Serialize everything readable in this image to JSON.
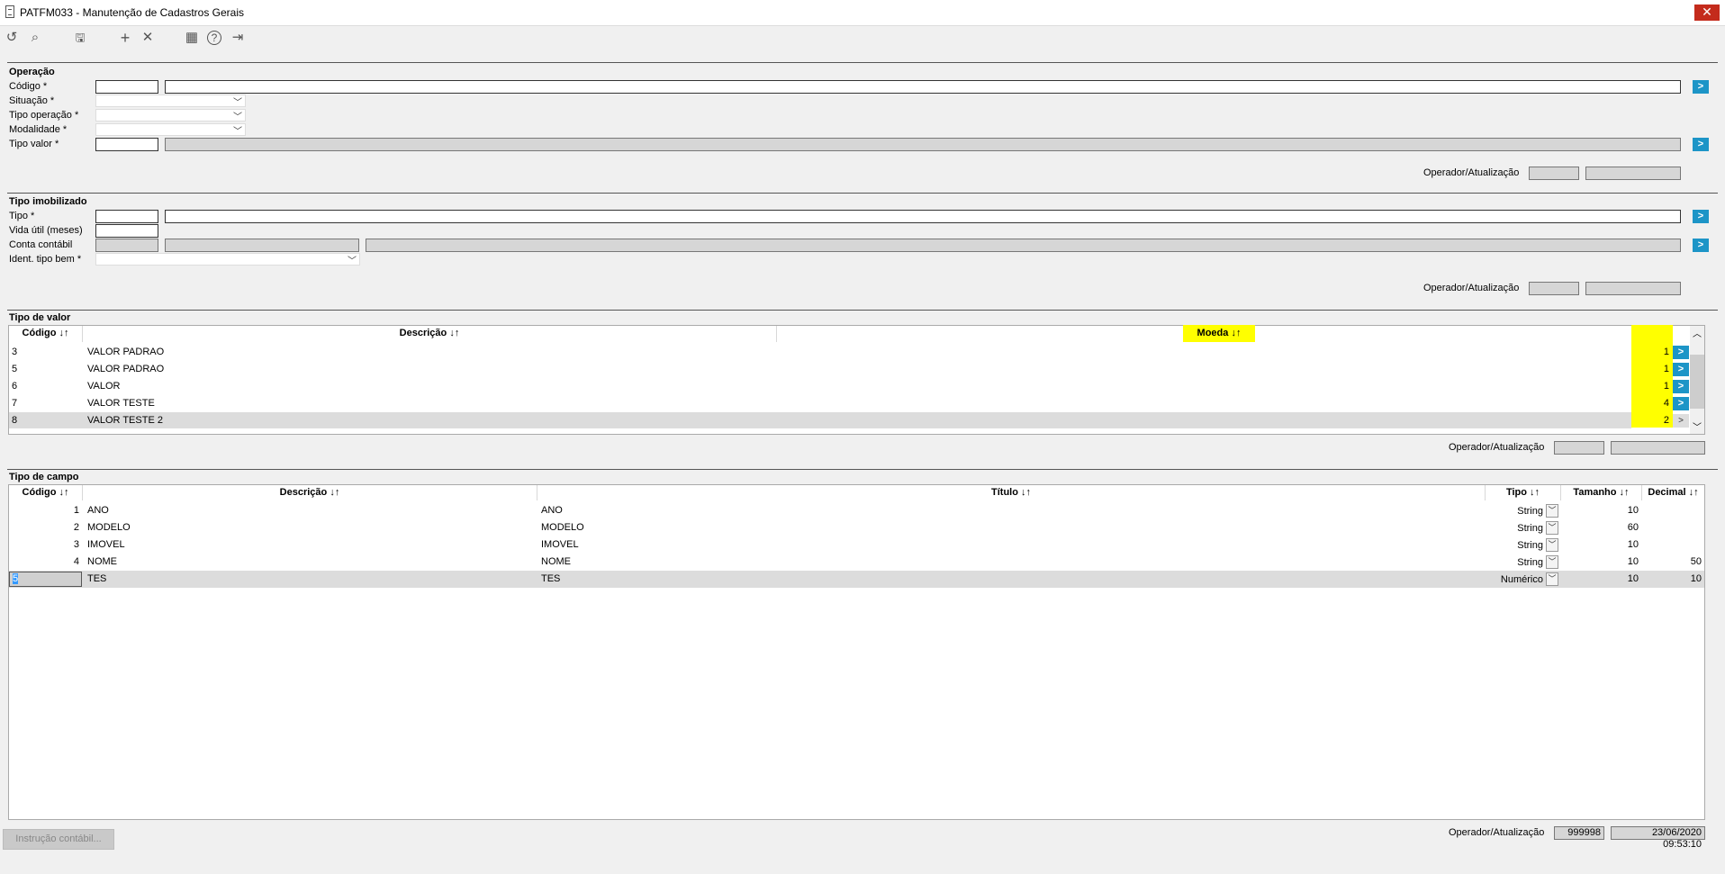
{
  "window": {
    "title": "PATFM033 - Manutenção de Cadastros Gerais",
    "close": "✕"
  },
  "toolbar": {
    "refresh": "↺",
    "search": "⌕",
    "save": "🖫",
    "add": "+",
    "remove": "✕",
    "calendar": "▦",
    "help": "?",
    "exit": "⇥"
  },
  "operacao": {
    "title": "Operação",
    "codigo": "Código *",
    "situacao": "Situação *",
    "tipo_operacao": "Tipo operação *",
    "modalidade": "Modalidade *",
    "tipo_valor": "Tipo valor *",
    "operador_label": "Operador/Atualização"
  },
  "tipo_imobilizado": {
    "title": "Tipo imobilizado",
    "tipo": "Tipo *",
    "vida_util": "Vida útil (meses)",
    "conta_contabil": "Conta contábil",
    "ident_tipo_bem": "Ident. tipo bem *",
    "operador_label": "Operador/Atualização"
  },
  "tipo_valor": {
    "title": "Tipo de valor",
    "columns": [
      "Código ↓↑",
      "Descrição ↓↑",
      "Moeda ↓↑"
    ],
    "rows": [
      {
        "codigo": "3",
        "descricao": "VALOR PADRAO",
        "moeda": "1"
      },
      {
        "codigo": "5",
        "descricao": "VALOR PADRAO",
        "moeda": "1"
      },
      {
        "codigo": "6",
        "descricao": "VALOR",
        "moeda": "1"
      },
      {
        "codigo": "7",
        "descricao": "VALOR TESTE",
        "moeda": "4"
      },
      {
        "codigo": "8",
        "descricao": "VALOR TESTE 2",
        "moeda": "2"
      }
    ],
    "row_button": ">",
    "operador_label": "Operador/Atualização"
  },
  "tipo_campo": {
    "title": "Tipo de campo",
    "columns": [
      "Código ↓↑",
      "Descrição ↓↑",
      "Título ↓↑",
      "Tipo ↓↑",
      "Tamanho ↓↑",
      "Decimal ↓↑"
    ],
    "rows": [
      {
        "codigo": "1",
        "descricao": "ANO",
        "titulo": "ANO",
        "tipo": "String",
        "tamanho": "10",
        "decimal": ""
      },
      {
        "codigo": "2",
        "descricao": "MODELO",
        "titulo": "MODELO",
        "tipo": "String",
        "tamanho": "60",
        "decimal": ""
      },
      {
        "codigo": "3",
        "descricao": "IMOVEL",
        "titulo": "IMOVEL",
        "tipo": "String",
        "tamanho": "10",
        "decimal": ""
      },
      {
        "codigo": "4",
        "descricao": "NOME",
        "titulo": "NOME",
        "tipo": "String",
        "tamanho": "10",
        "decimal": "50"
      },
      {
        "codigo": "5",
        "descricao": "TES",
        "titulo": "TES",
        "tipo": "Numérico",
        "tamanho": "10",
        "decimal": "10"
      }
    ]
  },
  "footer": {
    "instrucao_button": "Instrução contábil...",
    "operador_label": "Operador/Atualização",
    "operador": "999998",
    "atualizacao": "23/06/2020 09:53:10"
  },
  "colors": {
    "accent": "#1d95c7",
    "highlight": "#ffff00"
  }
}
